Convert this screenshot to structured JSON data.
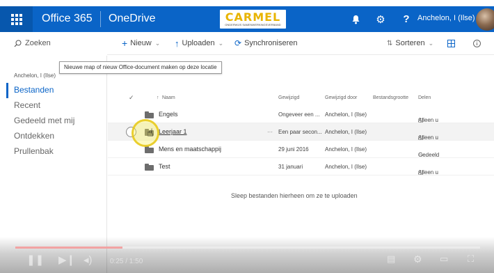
{
  "suitebar": {
    "app_name": "Office 365",
    "product": "OneDrive",
    "brand_logo": "CARMEL",
    "brand_tagline": "ONDERWIJS SAMENWERKINGSVERBAND",
    "bell_icon": "🔔",
    "gear_icon": "⚙",
    "help_icon": "?",
    "user_name": "Anchelon, I (Ilse)"
  },
  "search": {
    "placeholder": "Zoeken"
  },
  "commands": {
    "new": "Nieuw",
    "upload": "Uploaden",
    "sync": "Synchroniseren",
    "sort": "Sorteren"
  },
  "tooltip": "Nieuwe map of nieuw Office-document maken op deze locatie",
  "nav": {
    "user": "Anchelon, I (Ilse)",
    "items": [
      "Bestanden",
      "Recent",
      "Gedeeld met mij",
      "Ontdekken",
      "Prullenbak"
    ]
  },
  "table": {
    "headers": {
      "name": "Naam",
      "modified": "Gewijzigd",
      "modified_by": "Gewijzigd door",
      "size": "Bestandsgrootte",
      "sharing": "Delen"
    },
    "rows": [
      {
        "name": "Engels",
        "modified": "Ongeveer een ...",
        "modified_by": "Anchelon, I (Ilse)",
        "sharing": "Alleen u"
      },
      {
        "name": "Leerjaar 1",
        "modified": "Een paar secon...",
        "modified_by": "Anchelon, I (Ilse)",
        "sharing": "Alleen u"
      },
      {
        "name": "Mens en maatschappij",
        "modified": "29 juni 2016",
        "modified_by": "Anchelon, I (Ilse)",
        "sharing": "Gedeeld"
      },
      {
        "name": "Test",
        "modified": "31 januari",
        "modified_by": "Anchelon, I (Ilse)",
        "sharing": "Alleen u"
      }
    ],
    "more": "···"
  },
  "drop_hint": "Sleep bestanden hierheen om ze te uploaden",
  "player": {
    "time": "0:25 / 1:50",
    "progress": 0.23
  },
  "colors": {
    "suitebar": "#0a64c7",
    "accent": "#0a64c7",
    "logo": "#e8b400",
    "progress": "#f2a3a3"
  }
}
